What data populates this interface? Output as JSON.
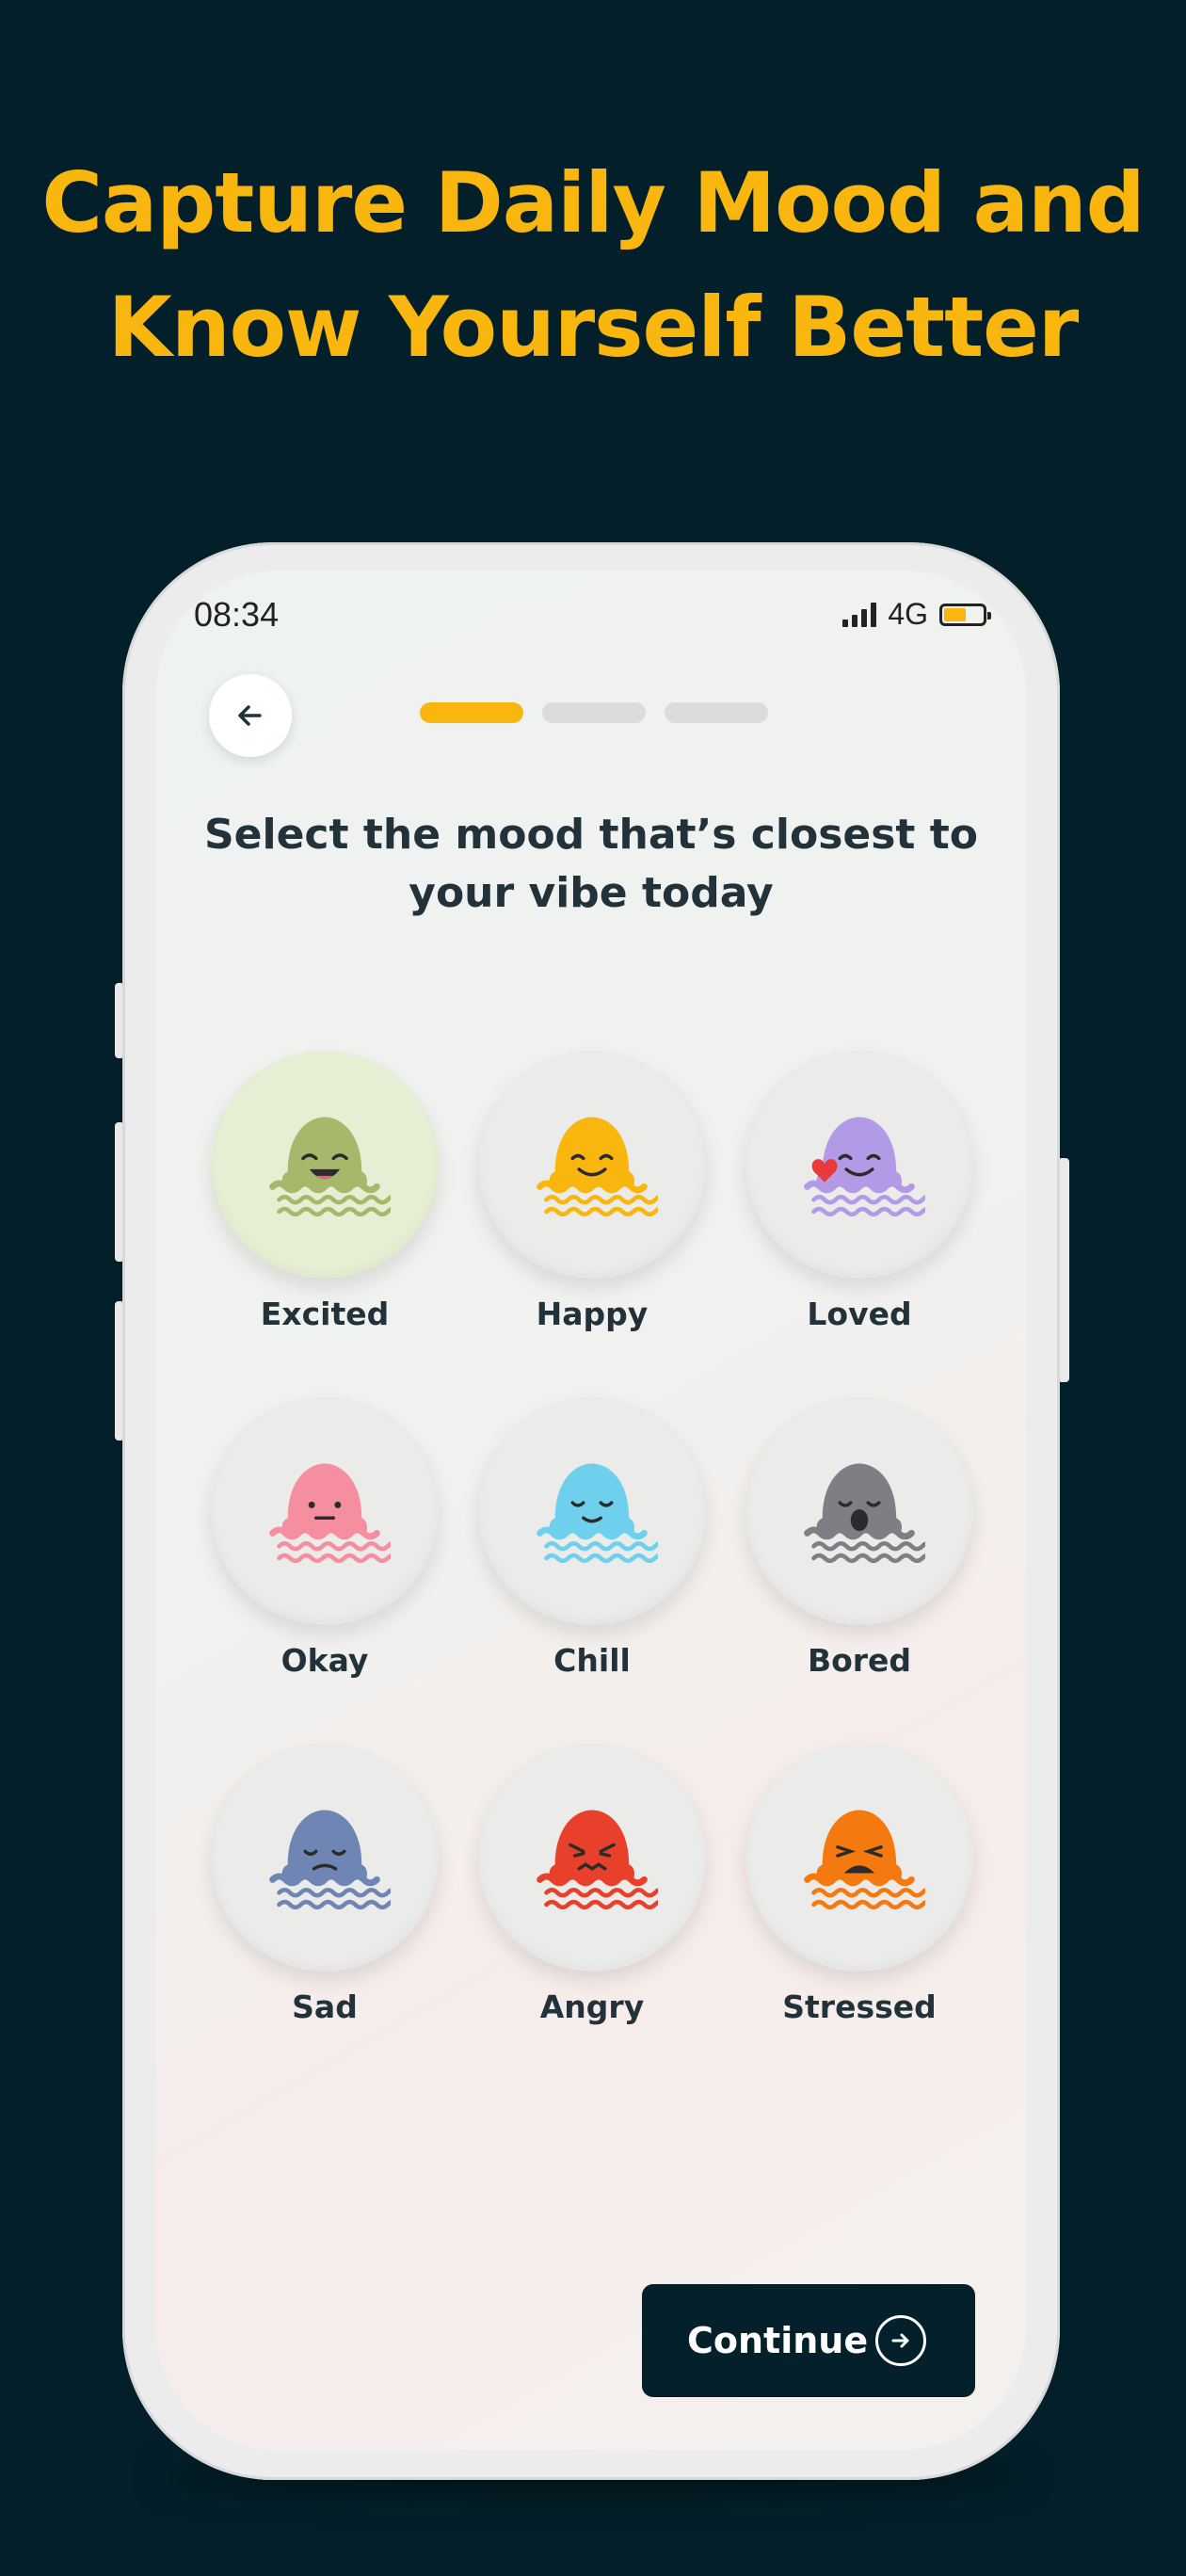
{
  "headline": {
    "line1": "Capture Daily Mood and",
    "line2": "Know Yourself Better"
  },
  "status_bar": {
    "time": "08:34",
    "network": "4G",
    "battery_level": 0.58
  },
  "onboarding": {
    "steps_total": 3,
    "current_step": 1,
    "prompt_line1": "Select the mood that’s closest to",
    "prompt_line2": "your vibe today",
    "selected_mood": "Excited"
  },
  "moods": [
    {
      "label": "Excited",
      "color": "#a8b86a",
      "face": "laugh"
    },
    {
      "label": "Happy",
      "color": "#f8b60e",
      "face": "smile"
    },
    {
      "label": "Loved",
      "color": "#b39ae6",
      "face": "smile-heart"
    },
    {
      "label": "Okay",
      "color": "#f58fa0",
      "face": "neutral"
    },
    {
      "label": "Chill",
      "color": "#6fd0ee",
      "face": "calm"
    },
    {
      "label": "Bored",
      "color": "#7d7f85",
      "face": "yawn"
    },
    {
      "label": "Sad",
      "color": "#6f86b4",
      "face": "sad"
    },
    {
      "label": "Angry",
      "color": "#e8402a",
      "face": "angry"
    },
    {
      "label": "Stressed",
      "color": "#f47a10",
      "face": "stressed"
    }
  ],
  "actions": {
    "continue_label": "Continue"
  },
  "colors": {
    "background": "#03202a",
    "accent": "#f8b60e",
    "dark_button": "#04202a"
  }
}
